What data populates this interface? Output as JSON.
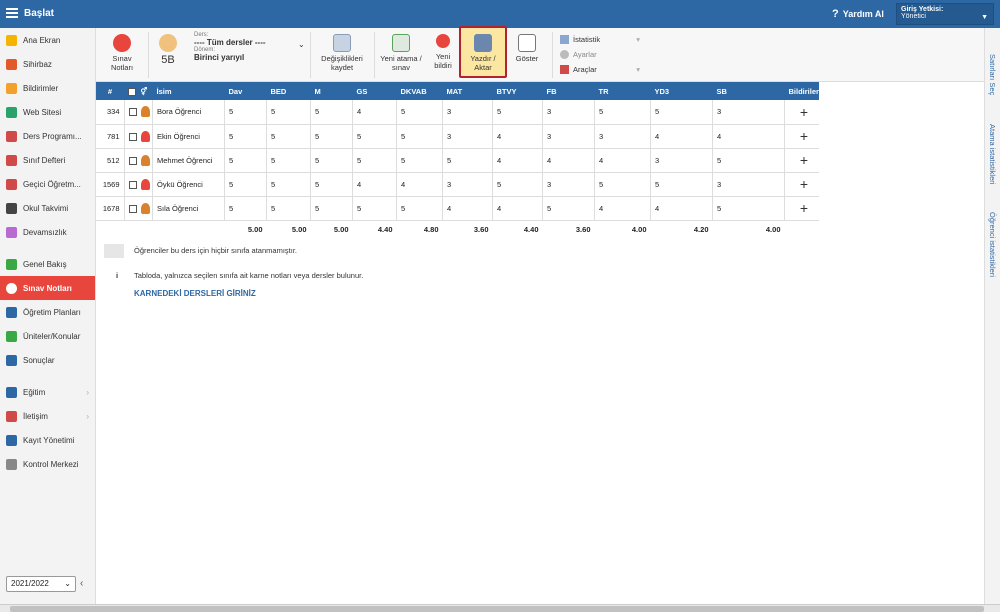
{
  "app": {
    "title": "Başlat",
    "help_label": "Yardım Al",
    "login_label": "Giriş Yetkisi:",
    "login_role": "Yönetici"
  },
  "sidebar": {
    "items": [
      {
        "label": "Ana Ekran",
        "icon": "star-icon",
        "color": "#f4b400"
      },
      {
        "label": "Sihirbaz",
        "icon": "wand-icon",
        "color": "#e05a2a"
      },
      {
        "label": "Bildirimler",
        "icon": "mail-icon",
        "color": "#f2a12c"
      },
      {
        "label": "Web Sitesi",
        "icon": "home-icon",
        "color": "#2aa36b"
      },
      {
        "label": "Ders Programı...",
        "icon": "calendar-icon",
        "color": "#d04a4a"
      },
      {
        "label": "Sınıf Defteri",
        "icon": "book-icon",
        "color": "#d04a4a"
      },
      {
        "label": "Geçici Öğretm...",
        "icon": "user-icon",
        "color": "#d04a4a"
      },
      {
        "label": "Okul Takvimi",
        "icon": "calendar-dark-icon",
        "color": "#444444"
      },
      {
        "label": "Devamsızlık",
        "icon": "absence-icon",
        "color": "#b86ad1"
      },
      {
        "label": "Genel Bakış",
        "icon": "overview-icon",
        "color": "#3aa845"
      },
      {
        "label": "Sınav Notları",
        "icon": "grades-icon",
        "color": "#e8453c",
        "active": true
      },
      {
        "label": "Öğretim Planları",
        "icon": "plan-icon",
        "color": "#2e68a4"
      },
      {
        "label": "Üniteler/Konular",
        "icon": "shield-icon",
        "color": "#3aa845"
      },
      {
        "label": "Sonuçlar",
        "icon": "chart-icon",
        "color": "#2e68a4"
      },
      {
        "label": "Eğitim",
        "icon": "education-icon",
        "color": "#2e68a4",
        "chevron": true
      },
      {
        "label": "İletişim",
        "icon": "chat-icon",
        "color": "#d04a4a",
        "chevron": true
      },
      {
        "label": "Kayıt Yönetimi",
        "icon": "pen-icon",
        "color": "#2e68a4"
      },
      {
        "label": "Kontrol Merkezi",
        "icon": "gear-icon",
        "color": "#888888"
      }
    ],
    "year": "2021/2022"
  },
  "toolbar": {
    "exam_notes": "Sınav Notları",
    "class_value": "5B",
    "ders_label": "Ders:",
    "ders_value": "---- Tüm dersler ----",
    "donem_label": "Dönem:",
    "donem_value": "Birinci yarıyıl",
    "save_label": "Değişiklikleri kaydet",
    "new_assign_label": "Yeni atama / sınav",
    "new_notif_label": "Yeni bildiri",
    "print_label": "Yazdır / Aktar",
    "show_label": "Göster",
    "stats_label": "İstatistik",
    "settings_label": "Ayarlar",
    "tools_label": "Araçlar"
  },
  "rightpanel": {
    "t1": "Satırları Seç",
    "t2": "Atama istatistikleri",
    "t3": "Öğrenci istatistikleri"
  },
  "table": {
    "headers": [
      "#",
      "",
      "",
      "İsim",
      "Dav",
      "BED",
      "M",
      "GS",
      "DKVAB",
      "MAT",
      "BTVY",
      "FB",
      "TR",
      "YD3",
      "SB",
      "Bildiriler"
    ],
    "rows": [
      {
        "no": "334",
        "name": "Bora Öğrenci",
        "vals": [
          "5",
          "5",
          "5",
          "4",
          "5",
          "3",
          "5",
          "3",
          "5",
          "5",
          "3"
        ]
      },
      {
        "no": "781",
        "name": "Ekin Öğrenci",
        "vals": [
          "5",
          "5",
          "5",
          "5",
          "5",
          "3",
          "4",
          "3",
          "3",
          "4",
          "4"
        ]
      },
      {
        "no": "512",
        "name": "Mehmet Öğrenci",
        "vals": [
          "5",
          "5",
          "5",
          "5",
          "5",
          "5",
          "4",
          "4",
          "4",
          "3",
          "5"
        ]
      },
      {
        "no": "1569",
        "name": "Öykü Öğrenci",
        "vals": [
          "5",
          "5",
          "5",
          "4",
          "4",
          "3",
          "5",
          "3",
          "5",
          "5",
          "3"
        ]
      },
      {
        "no": "1678",
        "name": "Sıla Öğrenci",
        "vals": [
          "5",
          "5",
          "5",
          "5",
          "5",
          "4",
          "4",
          "5",
          "4",
          "4",
          "5"
        ]
      }
    ],
    "averages": [
      "5.00",
      "5.00",
      "5.00",
      "4.40",
      "4.80",
      "3.60",
      "4.40",
      "3.60",
      "4.00",
      "4.20",
      "4.00"
    ]
  },
  "notes": {
    "unassigned": "Öğrenciler bu ders için hiçbir sınıfa atanmamıştır.",
    "info": "Tabloda, yalnızca seçilen sınıfa ait karne notları veya dersler bulunur.",
    "link": "KARNEDEKİ DERSLERİ GİRİNİZ"
  }
}
